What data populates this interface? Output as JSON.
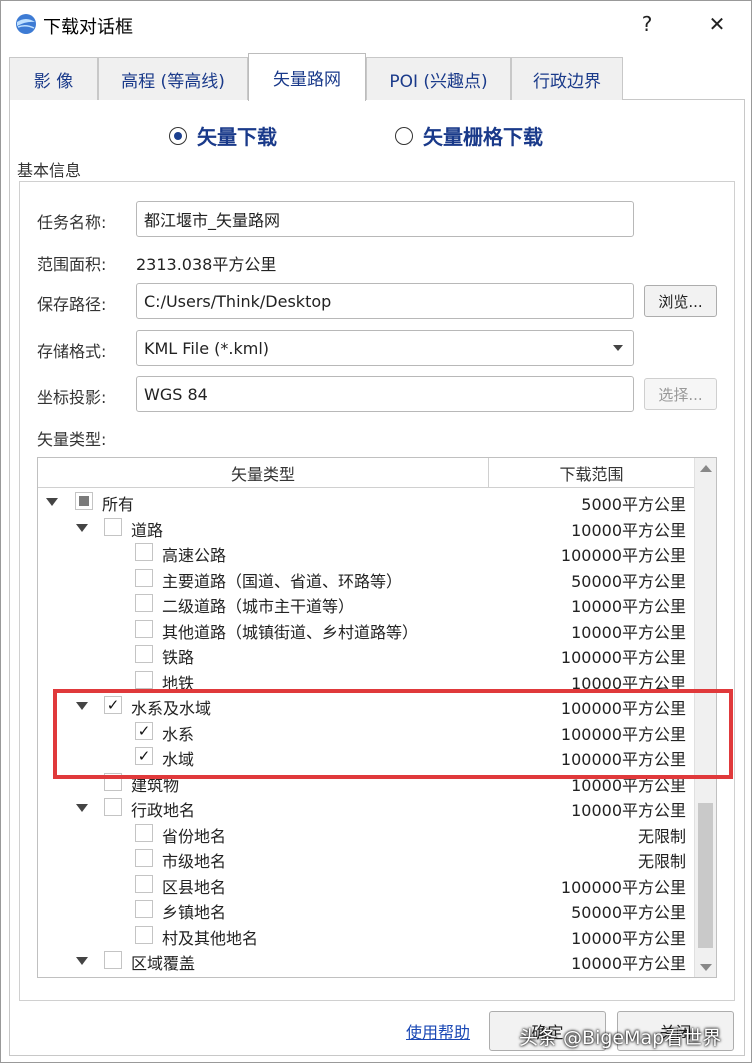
{
  "window": {
    "title": "下载对话框",
    "help_glyph": "?",
    "close_glyph": "✕"
  },
  "tabs": [
    {
      "label": "影 像"
    },
    {
      "label": "高程 (等高线)"
    },
    {
      "label": "矢量路网",
      "active": true
    },
    {
      "label": "POI (兴趣点)"
    },
    {
      "label": "行政边界"
    }
  ],
  "mode": {
    "vector_download": "矢量下载",
    "vector_raster_download": "矢量栅格下载",
    "selected": "矢量下载"
  },
  "basic_info": {
    "title": "基本信息",
    "task_name_label": "任务名称:",
    "task_name_value": "都江堰市_矢量路网",
    "area_label": "范围面积:",
    "area_value": "2313.038平方公里",
    "save_path_label": "保存路径:",
    "save_path_value": "C:/Users/Think/Desktop",
    "browse_button": "浏览...",
    "format_label": "存储格式:",
    "format_value": "KML File (*.kml)",
    "projection_label": "坐标投影:",
    "projection_value": "WGS 84",
    "select_button": "选择...",
    "vector_type_label": "矢量类型:"
  },
  "tree": {
    "col_type": "矢量类型",
    "col_range": "下载范围",
    "rows": [
      {
        "label": "所有",
        "range": "5000平方公里",
        "level": 0,
        "expander": true,
        "check": "partial"
      },
      {
        "label": "道路",
        "range": "10000平方公里",
        "level": 1,
        "expander": true,
        "check": "off"
      },
      {
        "label": "高速公路",
        "range": "100000平方公里",
        "level": 2,
        "check": "off"
      },
      {
        "label": "主要道路（国道、省道、环路等）",
        "range": "50000平方公里",
        "level": 2,
        "check": "off"
      },
      {
        "label": "二级道路（城市主干道等）",
        "range": "10000平方公里",
        "level": 2,
        "check": "off"
      },
      {
        "label": "其他道路（城镇街道、乡村道路等）",
        "range": "10000平方公里",
        "level": 2,
        "check": "off"
      },
      {
        "label": "铁路",
        "range": "100000平方公里",
        "level": 2,
        "check": "off"
      },
      {
        "label": "地铁",
        "range": "10000平方公里",
        "level": 2,
        "check": "off"
      },
      {
        "label": "水系及水域",
        "range": "100000平方公里",
        "level": 1,
        "expander": true,
        "check": "on"
      },
      {
        "label": "水系",
        "range": "100000平方公里",
        "level": 2,
        "check": "on"
      },
      {
        "label": "水域",
        "range": "100000平方公里",
        "level": 2,
        "check": "on"
      },
      {
        "label": "建筑物",
        "range": "10000平方公里",
        "level": 1,
        "check": "off"
      },
      {
        "label": "行政地名",
        "range": "10000平方公里",
        "level": 1,
        "expander": true,
        "check": "off"
      },
      {
        "label": "省份地名",
        "range": "无限制",
        "level": 2,
        "check": "off"
      },
      {
        "label": "市级地名",
        "range": "无限制",
        "level": 2,
        "check": "off"
      },
      {
        "label": "区县地名",
        "range": "100000平方公里",
        "level": 2,
        "check": "off"
      },
      {
        "label": "乡镇地名",
        "range": "50000平方公里",
        "level": 2,
        "check": "off"
      },
      {
        "label": "村及其他地名",
        "range": "10000平方公里",
        "level": 2,
        "check": "off"
      },
      {
        "label": "区域覆盖",
        "range": "10000平方公里",
        "level": 1,
        "expander": true,
        "check": "off"
      }
    ]
  },
  "footer": {
    "help_link": "使用帮助",
    "ok_button": "确定",
    "close_button": "关闭"
  },
  "watermark": "头条 @BigeMap看世界",
  "colors": {
    "accent": "#1a3a8a",
    "highlight_box": "#e0393b",
    "link": "#1a48b5"
  }
}
